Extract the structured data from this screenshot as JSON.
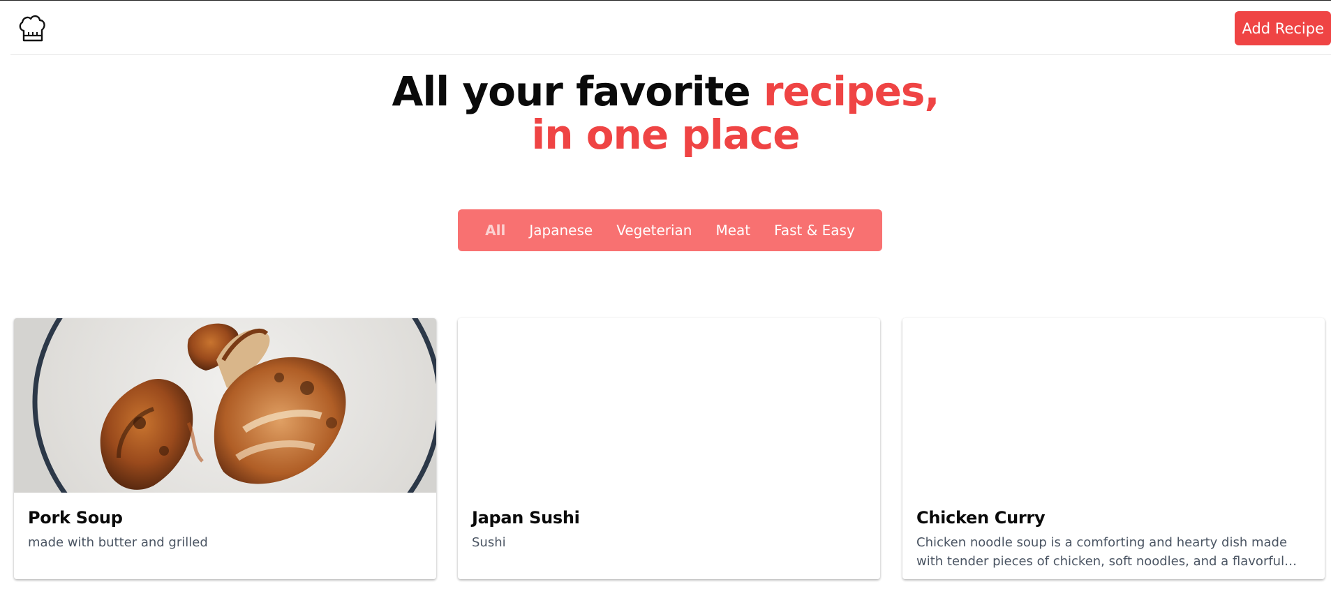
{
  "header": {
    "logo_icon": "chef-hat-icon",
    "add_button_label": "Add Recipe"
  },
  "hero": {
    "line1_black": "All your favorite ",
    "line1_red": "recipes,",
    "line2_red": "in one place"
  },
  "filters": {
    "items": [
      {
        "label": "All",
        "active": true
      },
      {
        "label": "Japanese",
        "active": false
      },
      {
        "label": "Vegeterian",
        "active": false
      },
      {
        "label": "Meat",
        "active": false
      },
      {
        "label": "Fast & Easy",
        "active": false
      }
    ]
  },
  "cards": [
    {
      "title": "Pork Soup",
      "description": "made with butter and grilled",
      "has_image": true
    },
    {
      "title": "Japan Sushi",
      "description": "Sushi",
      "has_image": false
    },
    {
      "title": "Chicken Curry",
      "description": "Chicken noodle soup is a comforting and hearty dish made with tender pieces of chicken, soft noodles, and a flavorful broth.",
      "has_image": false
    }
  ],
  "colors": {
    "accent": "#ef4444",
    "filter_bg": "#f87171"
  }
}
